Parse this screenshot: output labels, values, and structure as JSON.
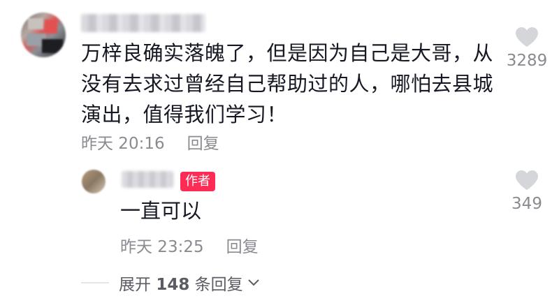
{
  "comment": {
    "username": "",
    "text": "万梓良确实落魄了，但是因为自己是大哥，从没有去求过曾经自己帮助过的人，哪怕去县城演出，值得我们学习！",
    "time": "昨天 20:16",
    "reply_label": "回复",
    "likes": "3289",
    "like_icon": "heart-icon"
  },
  "reply": {
    "username": "",
    "badge": "作者",
    "text": "一直可以",
    "time": "昨天 23:25",
    "reply_label": "回复",
    "likes": "349",
    "like_icon": "heart-icon"
  },
  "expand": {
    "prefix": "展开",
    "count": "148",
    "suffix": "条回复",
    "icon": "chevron-down-icon"
  },
  "colors": {
    "text": "#161823",
    "secondary": "#8a8b91",
    "badge": "#fe2c55",
    "heart": "#d5d6da"
  }
}
